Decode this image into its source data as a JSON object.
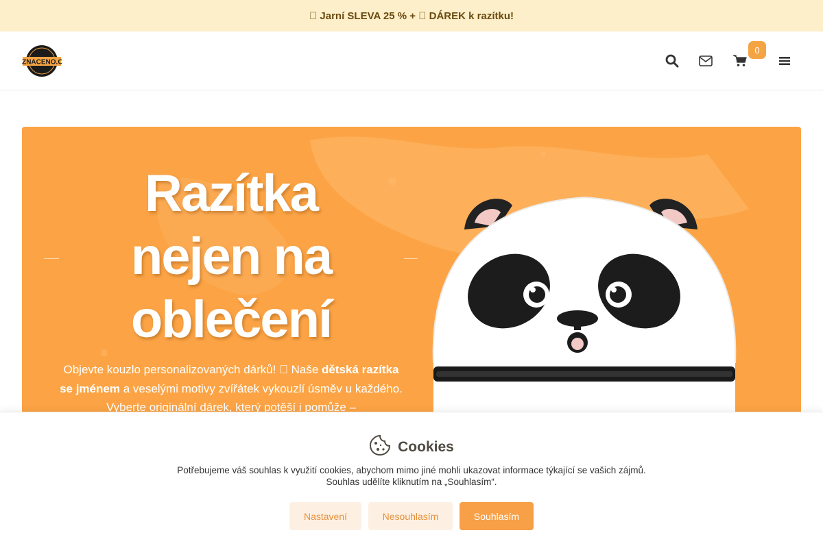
{
  "promo": {
    "text": "\u0000 Jarní SLEVA 25 % + \u0000 DÁREK k razítku!"
  },
  "header": {
    "logo_alt": "OZNACENO.CZ",
    "icons": [
      "search-icon",
      "envelope-icon",
      "cart-icon",
      "menu-icon"
    ],
    "cart_count": "0"
  },
  "hero": {
    "title_line1": "Razítka",
    "title_line2": "nejen na",
    "title_line3": "oblečení",
    "text_part1": "Objevte kouzlo personalizovaných dárků! \u0000 Naše ",
    "text_bold1": "dětská razítka se jménem",
    "text_part2": " a veselými motivy zvířátek vykouzlí úsměv u každého. Vyberte originální dárek, který potěší i pomůže –",
    "image_subject": "panda-stamp"
  },
  "cookies": {
    "title": "Cookies",
    "text_line1": "Potřebujeme váš souhlas k využití cookies, abychom mimo jiné mohli ukazovat informace týkající se vašich zájmů.",
    "text_line2": "Souhlas udělíte kliknutím na „Souhlasím“.",
    "btn_settings": "Nastavení",
    "btn_decline": "Nesouhlasím",
    "btn_accept": "Souhlasím"
  },
  "colors": {
    "accent": "#f7a047",
    "hero_bg": "#fca445",
    "promo_bg": "#fdefc9",
    "promo_text": "#6b4a10"
  }
}
